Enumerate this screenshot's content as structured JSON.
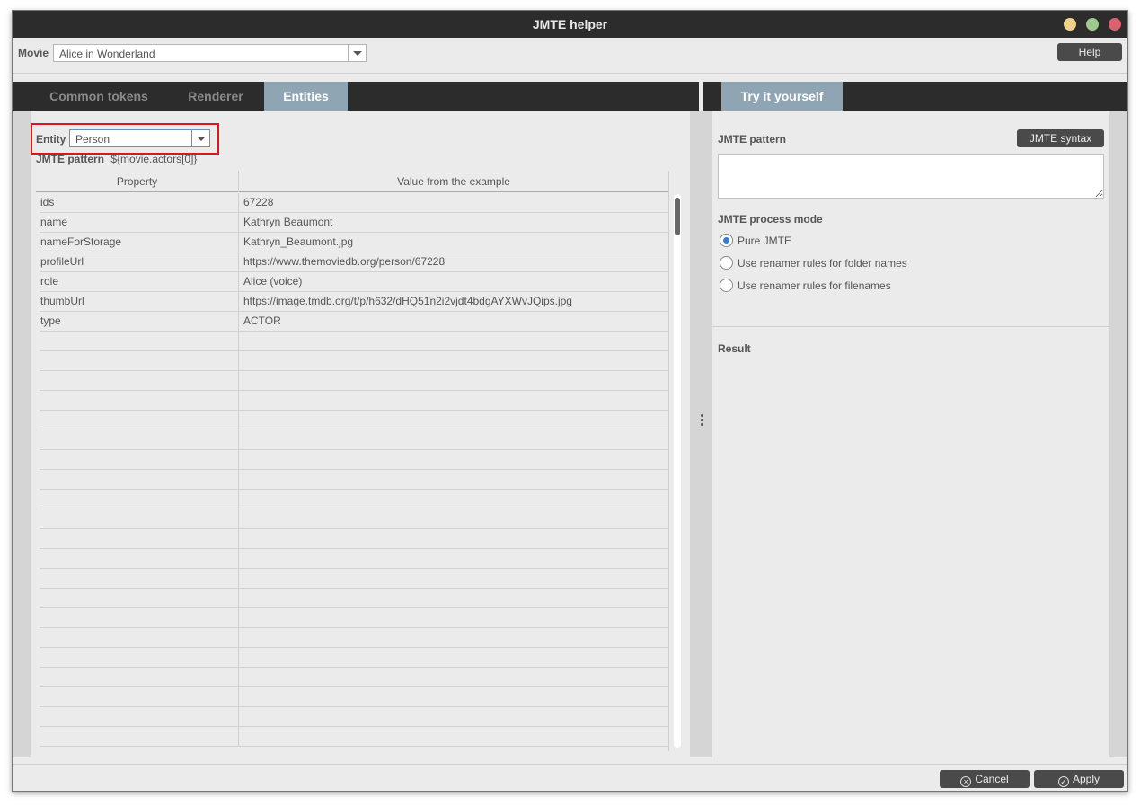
{
  "window": {
    "title": "JMTE helper"
  },
  "movie": {
    "label": "Movie",
    "value": "Alice in Wonderland",
    "help_label": "Help"
  },
  "tabs_left": [
    {
      "label": "Common tokens",
      "active": false
    },
    {
      "label": "Renderer",
      "active": false
    },
    {
      "label": "Entities",
      "active": true
    }
  ],
  "tabs_right": [
    {
      "label": "Try it yourself",
      "active": true
    }
  ],
  "entities": {
    "entity_label": "Entity",
    "entity_value": "Person",
    "pattern_label": "JMTE pattern",
    "pattern_value": "${movie.actors[0]}",
    "columns": {
      "property": "Property",
      "value": "Value from the example"
    },
    "rows": [
      {
        "property": "ids",
        "value": "67228"
      },
      {
        "property": "name",
        "value": "Kathryn Beaumont"
      },
      {
        "property": "nameForStorage",
        "value": "Kathryn_Beaumont.jpg"
      },
      {
        "property": "profileUrl",
        "value": "https://www.themoviedb.org/person/67228"
      },
      {
        "property": "role",
        "value": "Alice (voice)"
      },
      {
        "property": "thumbUrl",
        "value": "https://image.tmdb.org/t/p/h632/dHQ51n2i2vjdt4bdgAYXWvJQips.jpg"
      },
      {
        "property": "type",
        "value": "ACTOR"
      }
    ]
  },
  "try": {
    "pattern_label": "JMTE pattern",
    "syntax_label": "JMTE syntax",
    "pattern_value": "",
    "mode_label": "JMTE process mode",
    "modes": [
      {
        "label": "Pure JMTE",
        "selected": true
      },
      {
        "label": "Use renamer rules for folder names",
        "selected": false
      },
      {
        "label": "Use renamer rules for filenames",
        "selected": false
      }
    ],
    "result_label": "Result"
  },
  "footer": {
    "cancel_label": "Cancel",
    "apply_label": "Apply"
  },
  "colors": {
    "accent_tab": "#8fa5b4",
    "radio_selected": "#2f7fd6",
    "highlight_border": "#e0141e"
  }
}
